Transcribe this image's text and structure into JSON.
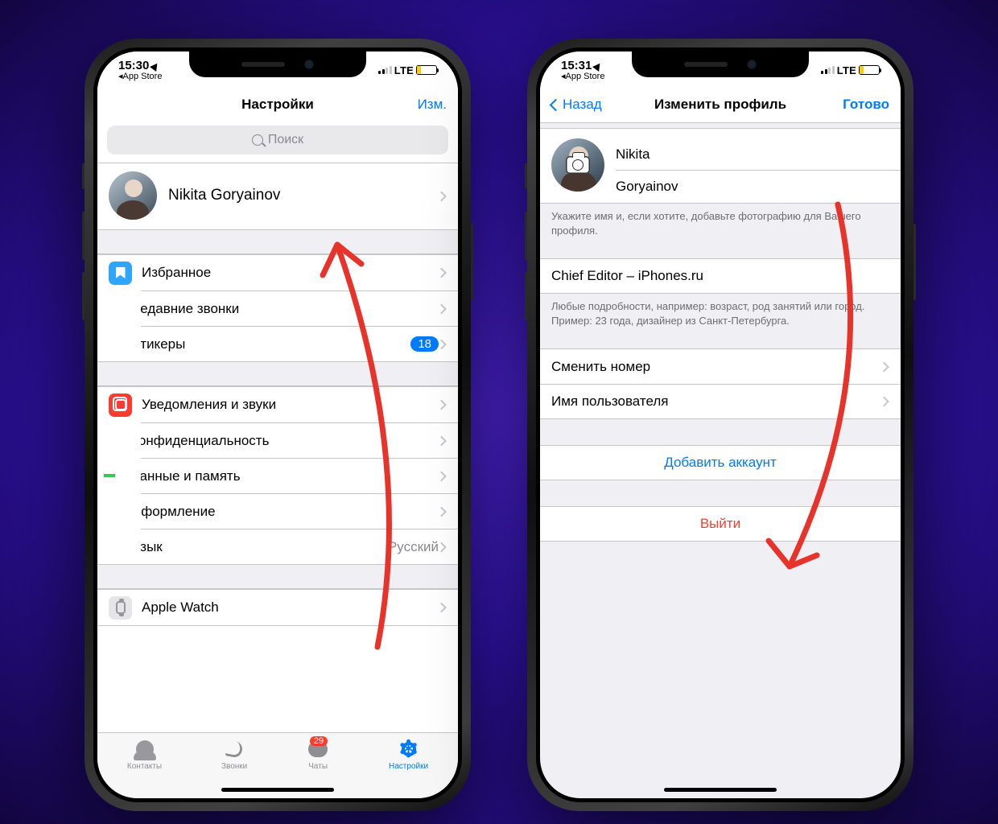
{
  "left": {
    "status": {
      "time": "15:30",
      "back_app": "App Store",
      "network": "LTE"
    },
    "nav": {
      "title": "Настройки",
      "edit": "Изм."
    },
    "search_placeholder": "Поиск",
    "profile_name": "Nikita Goryainov",
    "group1": [
      {
        "label": "Избранное",
        "color": "#2EA5FF"
      },
      {
        "label": "Недавние звонки",
        "color": "#30D158"
      },
      {
        "label": "Стикеры",
        "color": "#FF9F0A",
        "badge": "18"
      }
    ],
    "group2": [
      {
        "label": "Уведомления и звуки",
        "color": "#FF3B30"
      },
      {
        "label": "Конфиденциальность",
        "color": "#8E8E93"
      },
      {
        "label": "Данные и память",
        "color": "#34C759"
      },
      {
        "label": "Оформление",
        "color": "#2EA5FF"
      },
      {
        "label": "Язык",
        "color": "#BF5AF2",
        "detail": "Русский"
      }
    ],
    "group3": [
      {
        "label": "Apple Watch",
        "color": "#E5E5EA"
      }
    ],
    "tabs": {
      "contacts": "Контакты",
      "calls": "Звонки",
      "chats": "Чаты",
      "chats_badge": "29",
      "settings": "Настройки"
    }
  },
  "right": {
    "status": {
      "time": "15:31",
      "back_app": "App Store",
      "network": "LTE"
    },
    "nav": {
      "back": "Назад",
      "title": "Изменить профиль",
      "done": "Готово"
    },
    "first_name": "Nikita",
    "last_name": "Goryainov",
    "name_footer": "Укажите имя и, если хотите, добавьте фотографию для Вашего профиля.",
    "bio": "Chief Editor – iPhones.ru",
    "bio_footer": "Любые подробности, например: возраст, род занятий или город.\nПример: 23 года, дизайнер из Санкт-Петербурга.",
    "change_number": "Сменить номер",
    "username": "Имя пользователя",
    "add_account": "Добавить аккаунт",
    "logout": "Выйти"
  }
}
